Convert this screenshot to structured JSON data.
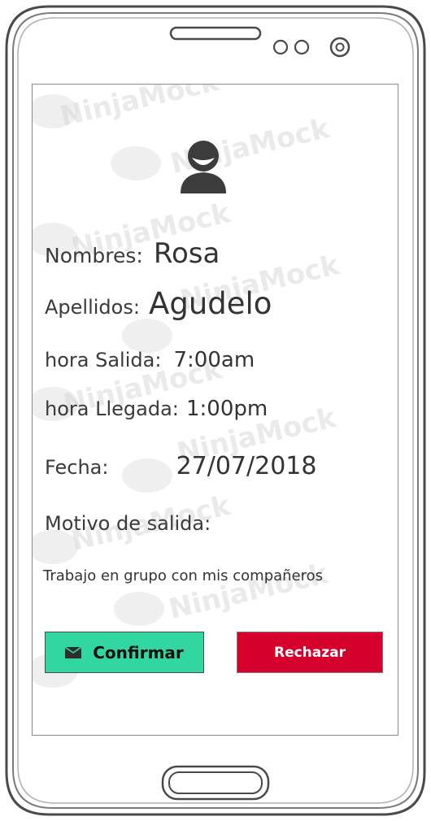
{
  "profile": {
    "avatar_icon": "user-avatar-icon",
    "nombres_label": "Nombres:",
    "nombres_value": "Rosa",
    "apellidos_label": "Apellidos:",
    "apellidos_value": "Agudelo",
    "hora_salida_label": "hora Salida:",
    "hora_salida_value": "7:00am",
    "hora_llegada_label": "hora Llegada:",
    "hora_llegada_value": "1:00pm",
    "fecha_label": "Fecha:",
    "fecha_value": "27/07/2018",
    "motivo_label": "Motivo de salida:",
    "motivo_value": "Trabajo en grupo con mis compañeros"
  },
  "actions": {
    "confirm_label": "Confirmar",
    "confirm_icon": "envelope-icon",
    "reject_label": "Rechazar"
  },
  "colors": {
    "confirm_bg": "#32d6a0",
    "reject_bg": "#d6002c"
  }
}
